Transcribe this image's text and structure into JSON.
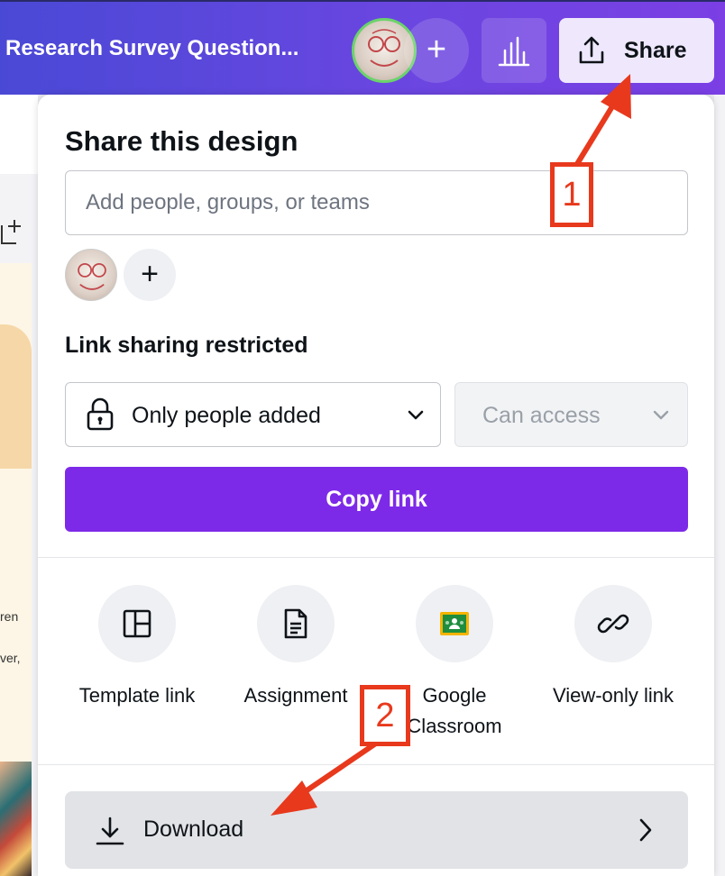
{
  "header": {
    "doc_title": "Research Survey Question...",
    "add_button": "+",
    "share_label": "Share"
  },
  "panel": {
    "title": "Share this design",
    "people_placeholder": "Add people, groups, or teams",
    "add_person": "+",
    "link_heading": "Link sharing restricted",
    "access_value": "Only people added",
    "permission_value": "Can access",
    "copy_link_label": "Copy link",
    "options": [
      {
        "label": "Template link",
        "icon": "template-icon"
      },
      {
        "label": "Assignment",
        "icon": "assignment-icon"
      },
      {
        "label": "Google Classroom",
        "icon": "google-classroom-icon"
      },
      {
        "label": "View-only link",
        "icon": "link-icon"
      }
    ],
    "download_label": "Download"
  },
  "canvas": {
    "text_fragment_1": "ren",
    "text_fragment_2": "ver,"
  },
  "annotations": {
    "step1": "1",
    "step2": "2"
  },
  "colors": {
    "header_gradient_start": "#4a49d6",
    "header_gradient_end": "#7b3fe4",
    "primary_purple": "#7d2ae8",
    "annotation_red": "#e8391d"
  }
}
